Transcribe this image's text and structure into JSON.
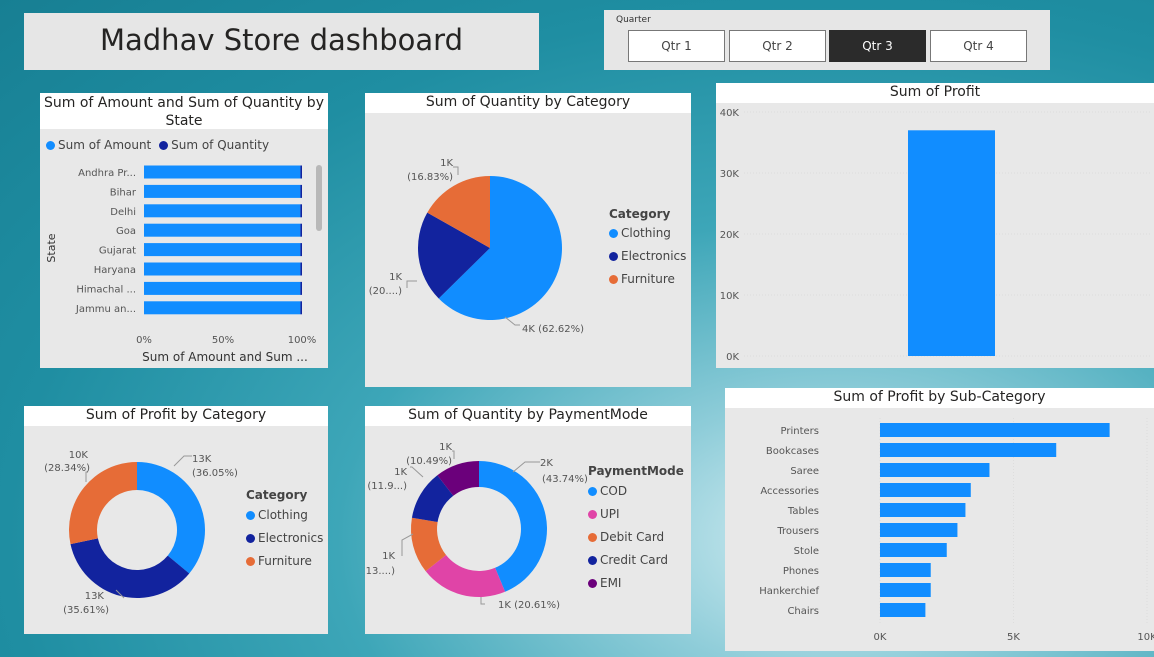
{
  "header": {
    "title": "Madhav Store dashboard"
  },
  "slicer": {
    "label": "Quarter",
    "options": [
      "Qtr 1",
      "Qtr 2",
      "Qtr 3",
      "Qtr 4"
    ],
    "selected": "Qtr 3"
  },
  "colors": {
    "blue": "#118dff",
    "navy": "#12239e",
    "orange": "#e66c37",
    "pink": "#e044a7",
    "purple": "#6b007b"
  },
  "chart_data": [
    {
      "id": "state",
      "type": "bar",
      "title": "Sum of Amount and Sum of Quantity by State",
      "title_lines": [
        "Sum of Amount and Sum of Quantity by",
        "State"
      ],
      "legend": [
        "Sum of Amount",
        "Sum of Quantity"
      ],
      "ylabel": "State",
      "xlabel": "Sum of Amount and Sum ...",
      "categories": [
        "Andhra Pr...",
        "Bihar",
        "Delhi",
        "Goa",
        "Gujarat",
        "Haryana",
        "Himachal ...",
        "Jammu an..."
      ],
      "series": [
        {
          "name": "Sum of Amount",
          "values": [
            99,
            99,
            99,
            99,
            99,
            99,
            99,
            99
          ]
        },
        {
          "name": "Sum of Quantity",
          "values": [
            1,
            1,
            1,
            1,
            1,
            1,
            1,
            1
          ]
        }
      ],
      "xticks": [
        "0%",
        "50%",
        "100%"
      ],
      "xlim": [
        0,
        100
      ]
    },
    {
      "id": "qty_category",
      "type": "pie",
      "title": "Sum of Quantity by Category",
      "legend_title": "Category",
      "slices": [
        {
          "name": "Clothing",
          "value": 62.62,
          "label_value": "4K",
          "label_pct": "(62.62%)"
        },
        {
          "name": "Electronics",
          "value": 20.55,
          "label_value": "1K",
          "label_pct": "(20....)"
        },
        {
          "name": "Furniture",
          "value": 16.83,
          "label_value": "1K",
          "label_pct": "(16.83%)"
        }
      ]
    },
    {
      "id": "profit",
      "type": "bar",
      "title": "Sum of Profit",
      "categories": [
        ""
      ],
      "values": [
        37000
      ],
      "yticks": [
        "0K",
        "10K",
        "20K",
        "30K",
        "40K"
      ],
      "ylim": [
        0,
        40000
      ]
    },
    {
      "id": "profit_category",
      "type": "pie",
      "title": "Sum of Profit by Category",
      "legend_title": "Category",
      "donut": true,
      "slices": [
        {
          "name": "Clothing",
          "value": 36.05,
          "label_value": "13K",
          "label_pct": "(36.05%)"
        },
        {
          "name": "Electronics",
          "value": 35.61,
          "label_value": "13K",
          "label_pct": "(35.61%)"
        },
        {
          "name": "Furniture",
          "value": 28.34,
          "label_value": "10K",
          "label_pct": "(28.34%)"
        }
      ]
    },
    {
      "id": "payment",
      "type": "pie",
      "title": "Sum of Quantity by PaymentMode",
      "legend_title": "PaymentMode",
      "donut": true,
      "slices": [
        {
          "name": "COD",
          "value": 43.74,
          "label_value": "2K",
          "label_pct": "(43.74%)"
        },
        {
          "name": "UPI",
          "value": 20.61,
          "label_value": "1K",
          "label_pct": "(20.61%)"
        },
        {
          "name": "Debit Card",
          "value": 13.3,
          "label_value": "1K",
          "label_pct": "(13....)"
        },
        {
          "name": "Credit Card",
          "value": 11.86,
          "label_value": "1K",
          "label_pct": "(11.9...)"
        },
        {
          "name": "EMI",
          "value": 10.49,
          "label_value": "1K",
          "label_pct": "(10.49%)"
        }
      ]
    },
    {
      "id": "subcategory",
      "type": "bar",
      "title": "Sum of Profit by Sub-Category",
      "categories": [
        "Printers",
        "Bookcases",
        "Saree",
        "Accessories",
        "Tables",
        "Trousers",
        "Stole",
        "Phones",
        "Hankerchief",
        "Chairs"
      ],
      "values": [
        8600,
        6600,
        4100,
        3400,
        3200,
        2900,
        2500,
        1900,
        1900,
        1700
      ],
      "xticks": [
        "0K",
        "5K",
        "10K"
      ],
      "xlim": [
        0,
        10000
      ]
    }
  ]
}
